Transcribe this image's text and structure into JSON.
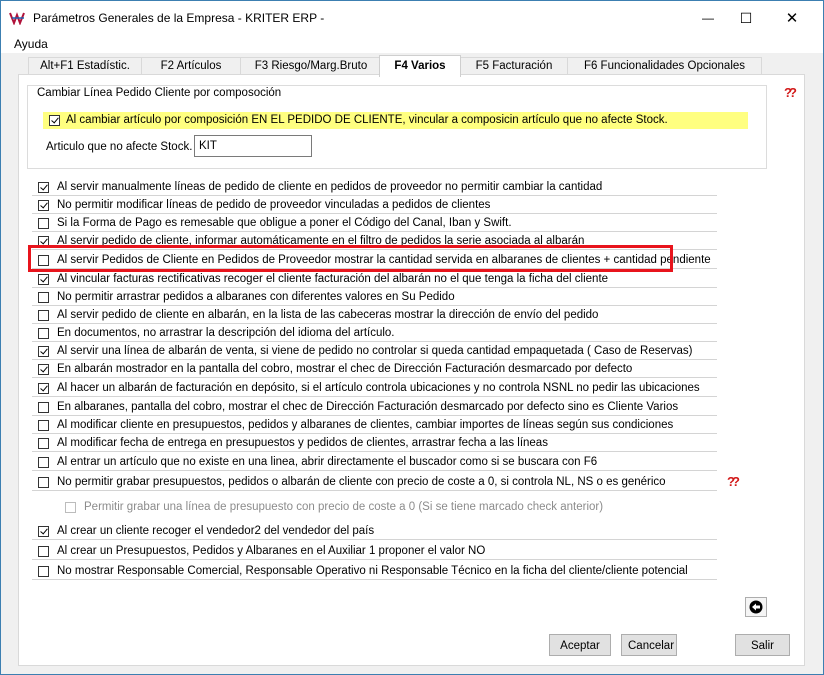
{
  "window": {
    "title": "Parámetros Generales de la Empresa - KRITER ERP -",
    "minimize_glyph": "—",
    "maximize_glyph": "☐",
    "close_glyph": "✕"
  },
  "menu": {
    "items": [
      "Ayuda"
    ]
  },
  "tabs": [
    {
      "label": "Alt+F1 Estadístic.",
      "active": false
    },
    {
      "label": "F2 Artículos",
      "active": false
    },
    {
      "label": "F3 Riesgo/Marg.Bruto",
      "active": false
    },
    {
      "label": "F4 Varios",
      "active": true
    },
    {
      "label": "F5 Facturación",
      "active": false
    },
    {
      "label": "F6 Funcionalidades Opcionales",
      "active": false
    }
  ],
  "group": {
    "title": "Cambiar Línea Pedido Cliente por composoción",
    "checkbox_label": "Al cambiar  artículo por composición EN EL PEDIDO DE CLIENTE, vincular a composicin artículo que no afecte Stock.",
    "checkbox_checked": true,
    "field_label": "Articulo que no afecte Stock.",
    "field_value": "KIT"
  },
  "options": [
    {
      "label": "Al servir manualmente líneas de pedido de cliente en pedidos de proveedor no permitir cambiar la cantidad",
      "checked": true
    },
    {
      "label": "No permitir modificar líneas de pedido de proveedor vinculadas a pedidos de clientes",
      "checked": true
    },
    {
      "label": "Si la Forma de Pago es remesable que obligue a poner el Código del Canal, Iban y Swift.",
      "checked": false
    },
    {
      "label": "Al servir pedido de cliente, informar automáticamente en el filtro de pedidos la serie asociada al albarán",
      "checked": true
    },
    {
      "label": "Al servir Pedidos de Cliente en Pedidos de Proveedor mostrar la cantidad servida en albaranes de clientes + cantidad pendiente",
      "checked": false
    },
    {
      "label": "Al vincular facturas rectificativas recoger el cliente facturación del albarán no el que tenga la ficha del cliente",
      "checked": true
    },
    {
      "label": "No permitir arrastrar pedidos a albaranes con diferentes valores en Su Pedido",
      "checked": false
    },
    {
      "label": "Al servir pedido de cliente en albarán, en la lista de las cabeceras mostrar la dirección de envío del pedido",
      "checked": false
    },
    {
      "label": "En documentos, no arrastrar la descripción del idioma del artículo.",
      "checked": false
    },
    {
      "label": "Al servir una línea de albarán de venta, si viene de pedido no controlar si queda cantidad empaquetada ( Caso de Reservas)",
      "checked": true
    },
    {
      "label": "En albarán mostrador en la pantalla del cobro, mostrar el chec de Dirección Facturación desmarcado por defecto",
      "checked": true
    },
    {
      "label": "Al hacer un albarán de facturación en depósito, si el artículo controla ubicaciones y no controla NSNL no pedir las ubicaciones",
      "checked": true
    },
    {
      "label": "En albaranes, pantalla del cobro, mostrar el chec de Dirección Facturación desmarcado por defecto sino es Cliente Varios",
      "checked": false
    },
    {
      "label": "Al modificar cliente en presupuestos, pedidos y albaranes de clientes, cambiar importes de líneas según sus condiciones",
      "checked": false
    },
    {
      "label": "Al modificar fecha de entrega en presupuestos y pedidos de clientes, arrastrar fecha a las líneas",
      "checked": false
    },
    {
      "label": "Al entrar un artículo que no existe en una linea, abrir directamente el buscador como si se buscara con F6",
      "checked": false
    },
    {
      "label": "No permitir grabar presupuestos, pedidos o albarán de cliente con precio de coste a 0, si controla NL, NS o es genérico",
      "checked": false
    }
  ],
  "sub_option": {
    "label": "Permitir grabar una línea de presupuesto con precio de coste a 0 (Si se tiene marcado check anterior)",
    "checked": false,
    "disabled": true
  },
  "options2": [
    {
      "label": "Al crear un cliente recoger el vendedor2 del vendedor del país",
      "checked": true
    },
    {
      "label": "Al crear un Presupuestos, Pedidos y Albaranes en el Auxiliar 1 proponer el valor NO",
      "checked": false
    },
    {
      "label": "No mostrar Responsable Comercial, Responsable Operativo ni Responsable Técnico en la ficha del cliente/cliente potencial",
      "checked": false
    }
  ],
  "buttons": {
    "accept": "Aceptar",
    "cancel": "Cancelar",
    "exit": "Salir"
  },
  "colors": {
    "highlight_yellow": "#ffff80",
    "annotation_red": "#e8141c",
    "title_border": "#3c7fb1"
  }
}
